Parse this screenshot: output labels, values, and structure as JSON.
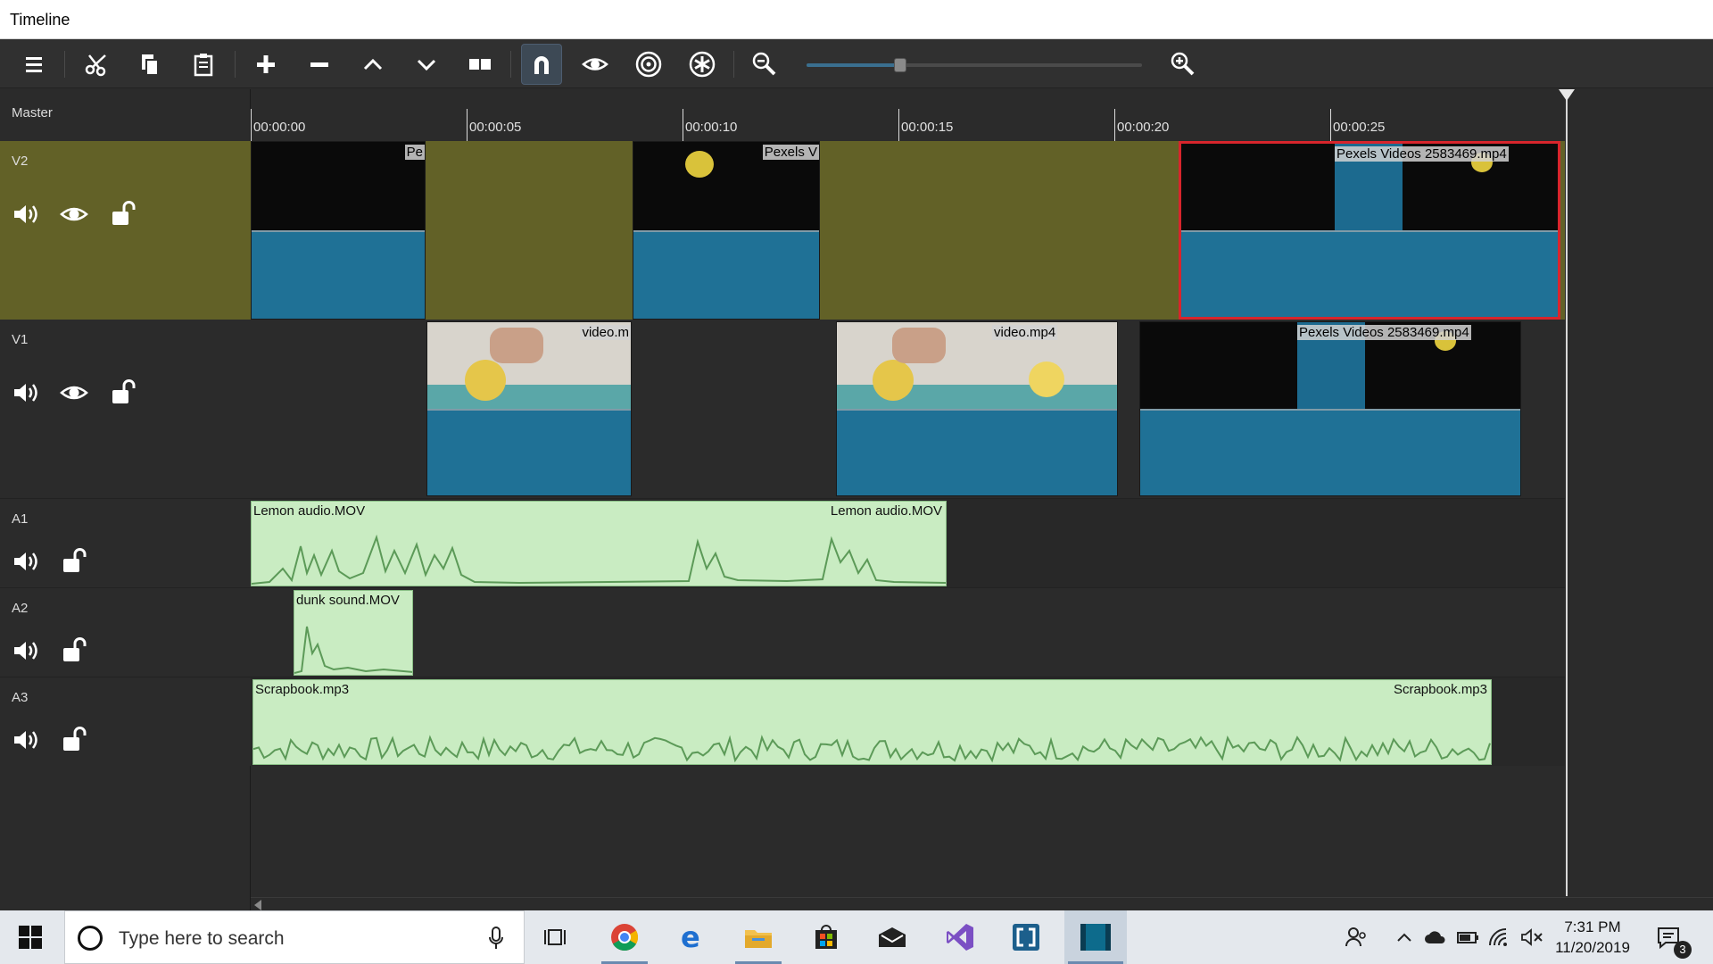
{
  "window": {
    "title": "Timeline"
  },
  "toolbar": {
    "buttons": [
      "menu-icon",
      "cut-icon",
      "copy-icon",
      "paste-icon",
      "append-icon",
      "remove-icon",
      "lift-icon",
      "overwrite-icon",
      "split-icon",
      "snap-icon",
      "scrub-icon",
      "ripple-icon",
      "ripple-all-icon",
      "zoom-out-icon",
      "zoom-in-icon"
    ],
    "snap_active": true,
    "zoom_level": 0.28
  },
  "master": {
    "label": "Master"
  },
  "ruler": {
    "ticks": [
      "00:00:00",
      "00:00:05",
      "00:00:10",
      "00:00:15",
      "00:00:20",
      "00:00:25"
    ]
  },
  "tracks": [
    {
      "name": "V2",
      "kind": "video"
    },
    {
      "name": "V1",
      "kind": "video"
    },
    {
      "name": "A1",
      "kind": "audio"
    },
    {
      "name": "A2",
      "kind": "audio"
    },
    {
      "name": "A3",
      "kind": "audio"
    }
  ],
  "clips": {
    "v2_1": "Pe",
    "v2_2": "Pexels V",
    "v2_3": "Pexels Videos 2583469.mp4",
    "v1_1": "video.m",
    "v1_2": "video.mp4",
    "v1_3": "Pexels Videos 2583469.mp4",
    "a1_left": "Lemon audio.MOV",
    "a1_right": "Lemon audio.MOV",
    "a2": "dunk sound.MOV",
    "a3_left": "Scrapbook.mp3",
    "a3_right": "Scrapbook.mp3"
  },
  "colors": {
    "selected_track": "#626127",
    "video_bottom": "#1f7196",
    "audio_clip": "#c9ecc2",
    "selection_border": "#d8252c"
  },
  "taskbar": {
    "search_placeholder": "Type here to search",
    "apps": [
      "task-view-icon",
      "chrome-icon",
      "edge-icon",
      "file-explorer-icon",
      "store-icon",
      "mail-icon",
      "visual-studio-icon",
      "app-icon",
      "shotcut-icon"
    ],
    "time": "7:31 PM",
    "date": "11/20/2019",
    "notification_count": "3"
  }
}
